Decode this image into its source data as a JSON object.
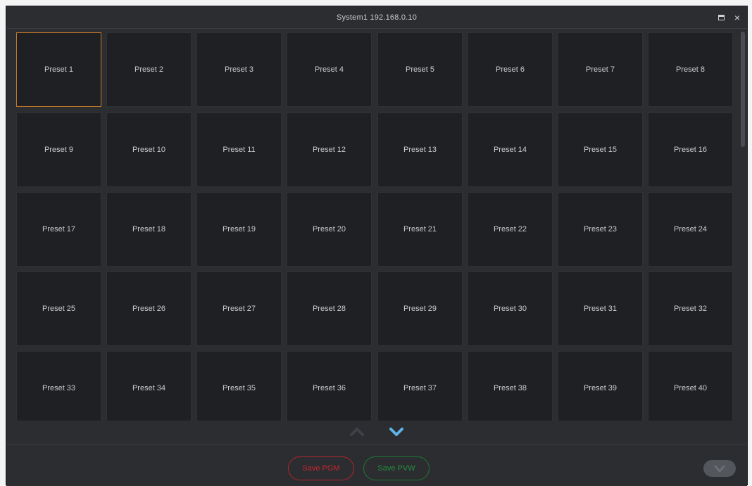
{
  "window": {
    "title": "System1 192.168.0.10",
    "maximize_icon": "maximize-icon",
    "close_icon": "close-icon",
    "close_label": "×"
  },
  "grid": {
    "columns": 8,
    "selected_index": 0,
    "selected_color": "#c77a2a",
    "presets": [
      "Preset 1",
      "Preset 2",
      "Preset 3",
      "Preset 4",
      "Preset 5",
      "Preset 6",
      "Preset 7",
      "Preset 8",
      "Preset 9",
      "Preset 10",
      "Preset 11",
      "Preset 12",
      "Preset 13",
      "Preset 14",
      "Preset 15",
      "Preset 16",
      "Preset 17",
      "Preset 18",
      "Preset 19",
      "Preset 20",
      "Preset 21",
      "Preset 22",
      "Preset 23",
      "Preset 24",
      "Preset 25",
      "Preset 26",
      "Preset 27",
      "Preset 28",
      "Preset 29",
      "Preset 30",
      "Preset 31",
      "Preset 32",
      "Preset 33",
      "Preset 34",
      "Preset 35",
      "Preset 36",
      "Preset 37",
      "Preset 38",
      "Preset 39",
      "Preset 40"
    ]
  },
  "pager": {
    "up_icon": "chevron-up-icon",
    "down_icon": "chevron-down-icon",
    "up_color": "#3e4146",
    "down_color": "#5fb3e6"
  },
  "actions": {
    "save_pgm_label": "Save PGM",
    "save_pvw_label": "Save PVW",
    "save_pgm_color": "#c8262e",
    "save_pvw_color": "#23903b",
    "lock_icon": "lock-toggle-icon"
  }
}
